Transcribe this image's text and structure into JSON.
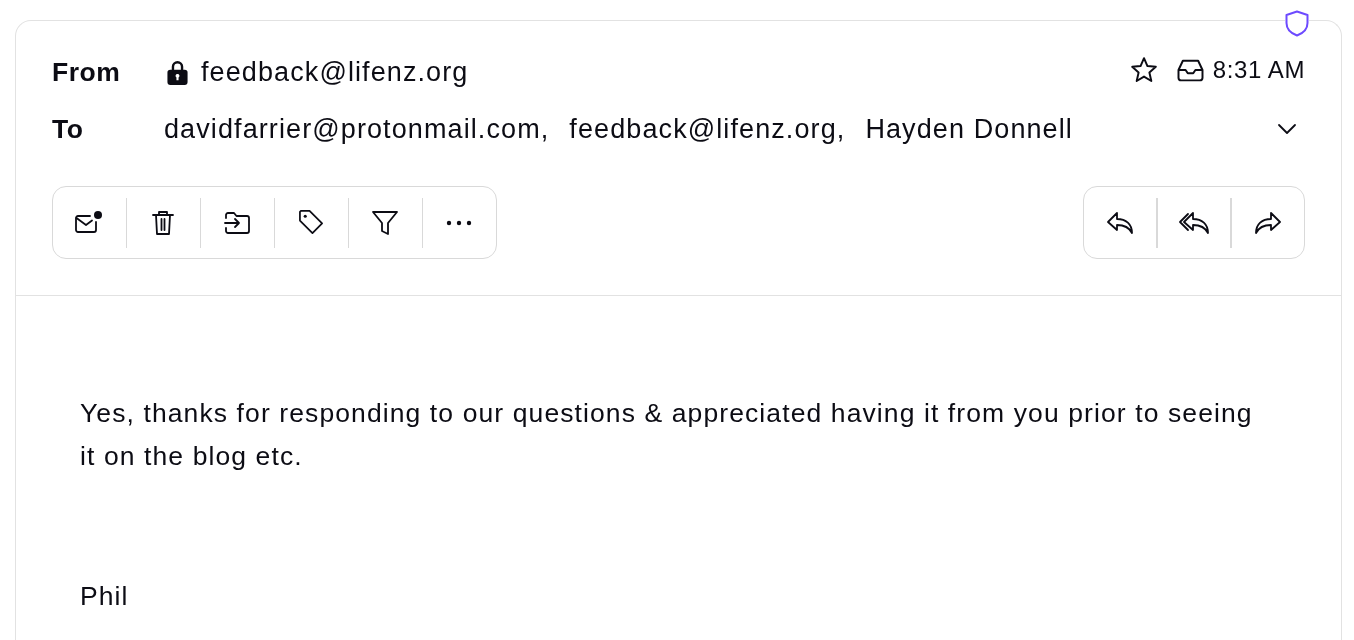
{
  "message": {
    "from": {
      "label": "From",
      "address": "feedback@lifenz.org"
    },
    "to": {
      "label": "To",
      "recipients": [
        "davidfarrier@protonmail.com,",
        "feedback@lifenz.org,",
        "Hayden Donnell"
      ],
      "expanded": false
    },
    "starred": false,
    "time": "8:31 AM"
  },
  "body": {
    "paragraphs": [
      "Yes, thanks for responding to our questions & appreciated having it from you prior to seeing it on the blog etc.",
      "Phil"
    ]
  }
}
